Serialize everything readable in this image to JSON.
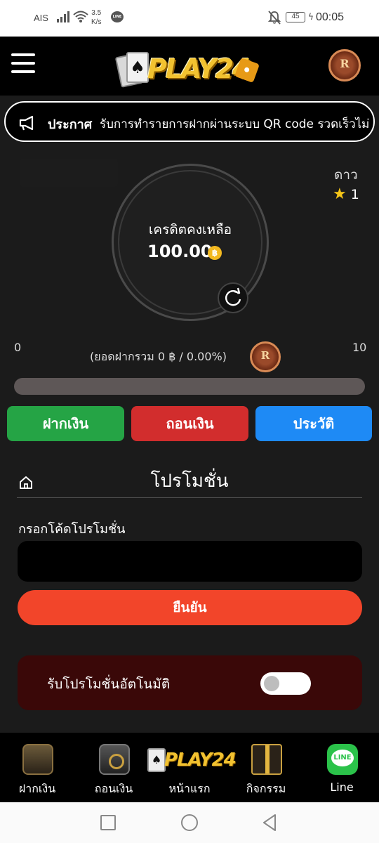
{
  "status_bar": {
    "carrier": "AIS",
    "speed_value": "3.5",
    "speed_unit": "K/s",
    "line_badge": "LINE",
    "battery": "45",
    "time": "00:05"
  },
  "header": {
    "logo_text": "PLAY24",
    "colors": {
      "logo_gold": "#f2c230",
      "background": "#000000"
    }
  },
  "announcement": {
    "label": "ประกาศ",
    "text": "รับการทำรายการฝากผ่านระบบ QR code รวดเร็วไม่"
  },
  "credit": {
    "label": "เครดิตคงเหลือ",
    "amount": "100.00",
    "coin_symbol": "฿"
  },
  "stars": {
    "label": "ดาว",
    "count": "1"
  },
  "rank_progress": {
    "min": "0",
    "max": "10",
    "deposit_total": "(ยอดฝากรวม 0 ฿ / 0.00%)",
    "percent": 0
  },
  "actions": {
    "deposit": "ฝากเงิน",
    "withdraw": "ถอนเงิน",
    "history": "ประวัติ",
    "colors": {
      "deposit": "#25a445",
      "withdraw": "#d22d2d",
      "history": "#1e8af5"
    }
  },
  "promotion": {
    "title": "โปรโมชั่น",
    "input_label": "กรอกโค้ดโปรโมชั่น",
    "input_value": "",
    "input_placeholder": "",
    "confirm": "ยืนยัน",
    "auto_label": "รับโปรโมชั่นอัตโนมัติ",
    "auto_enabled": false
  },
  "bottom_nav": {
    "items": [
      {
        "label": "ฝากเงิน",
        "icon": "wallet-icon"
      },
      {
        "label": "ถอนเงิน",
        "icon": "safe-icon"
      },
      {
        "label": "หน้าแรก",
        "icon": "play24-logo-icon"
      },
      {
        "label": "กิจกรรม",
        "icon": "gift-icon"
      },
      {
        "label": "Line",
        "icon": "line-icon"
      }
    ],
    "logo_text": "PLAY24"
  }
}
